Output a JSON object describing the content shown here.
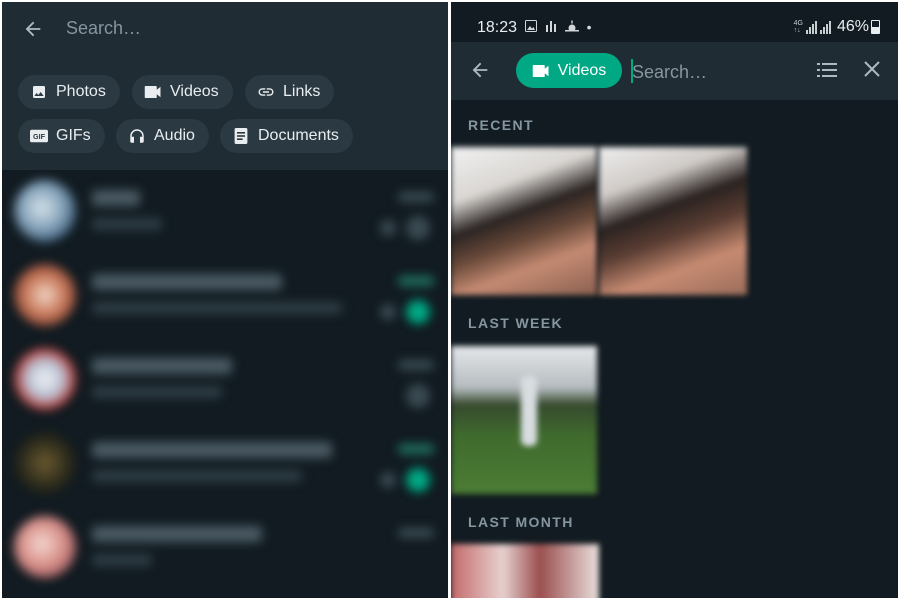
{
  "left": {
    "search": {
      "placeholder": "Search…",
      "back_icon": "arrow-left-icon"
    },
    "chips": [
      {
        "label": "Photos",
        "icon": "image-icon"
      },
      {
        "label": "Videos",
        "icon": "videocam-icon"
      },
      {
        "label": "Links",
        "icon": "link-icon"
      },
      {
        "label": "GIFs",
        "icon": "gif-icon"
      },
      {
        "label": "Audio",
        "icon": "headphones-icon"
      },
      {
        "label": "Documents",
        "icon": "document-icon"
      }
    ],
    "chat_count_visible": 5
  },
  "right": {
    "status_bar": {
      "time": "18:23",
      "battery": "46%"
    },
    "search": {
      "filter_chip": "Videos",
      "placeholder": "Search…",
      "back_icon": "arrow-left-icon",
      "list_icon": "list-view-icon",
      "close_icon": "close-icon"
    },
    "sections": [
      {
        "label": "RECENT"
      },
      {
        "label": "LAST WEEK"
      },
      {
        "label": "LAST MONTH"
      }
    ]
  },
  "colors": {
    "background": "#111b21",
    "header": "#202c33",
    "chip": "#2a3942",
    "accent": "#00a884",
    "text": "#e9edef",
    "muted": "#8696a0"
  }
}
